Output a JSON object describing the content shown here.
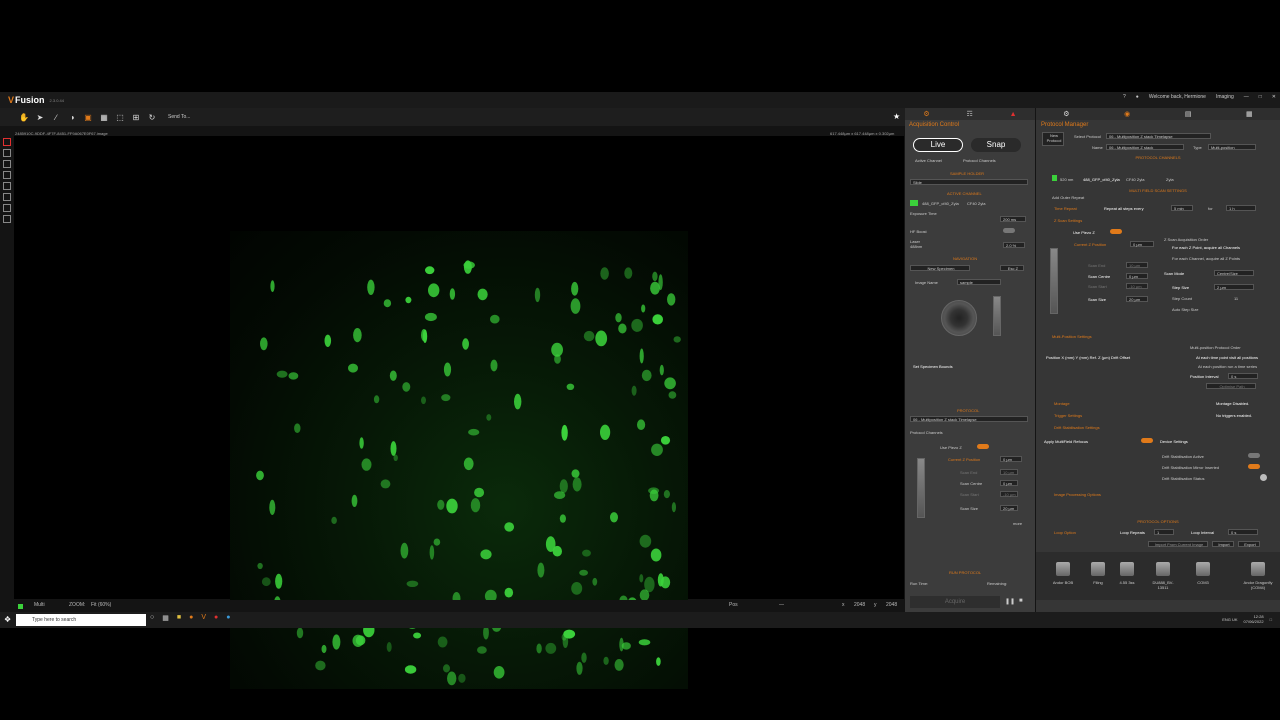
{
  "app": {
    "name": "Fusion",
    "version": "2.3.0.44",
    "welcome": "Welcome back, Hermione",
    "mode": "Imaging"
  },
  "toolbar": {
    "send_to": "Send To..."
  },
  "viewer": {
    "image_info": "2485910C-9DDF-4F7F-8451-FF9A067E0F67.image",
    "image_size": "617.448µm x 617.448µm x 0.302µm"
  },
  "statusbar": {
    "multi": "Multi",
    "zoom_label": "ZOOM:",
    "zoom_value": "Fit (60%)",
    "pos_label": "Pos",
    "pos_value": "—",
    "x_label": "x",
    "x_value": "2048",
    "y_label": "y",
    "y_value": "2048"
  },
  "acquisition": {
    "title": "Acquisition Control",
    "live": "Live",
    "snap": "Snap",
    "active_channel_radio": "Active Channel",
    "protocol_channels_radio": "Protocol Channels",
    "sample_holder": "SAMPLE HOLDER",
    "holder_value": "Slide",
    "active_channel": "ACTIVE CHANNEL",
    "channel_name": "488_GFP_cf40_Zyla",
    "channel_camera": "CF40 Zyla",
    "exposure_label": "Exposure Time",
    "exposure_value": "200 ms",
    "hf_boost": "HF Boost",
    "laser_label": "Laser",
    "laser_sub": "488nm",
    "laser_value": "2.0 %",
    "navigation": "NAVIGATION",
    "new_specimen": "New Specimen",
    "esc_z": "Esc Z",
    "image_name_label": "Image Name",
    "image_name_value": "sample",
    "set_specimen_bounds": "Set Specimen Bounds",
    "protocol": "PROTOCOL",
    "protocol_value": "06 - Multiposition Z stack Timelapse",
    "protocol_channels": "Protocol Channels",
    "use_piezo": "Use Piezo Z",
    "piezo_toggle": "ON",
    "current_z": "Current Z Position",
    "current_z_value": "0 µm",
    "scan_end": "Scan End",
    "scan_end_value": "10 µm",
    "scan_centre": "Scan Centre",
    "scan_centre_value": "0 µm",
    "scan_start": "Scan Start",
    "scan_start_value": "-10 µm",
    "scan_size": "Scan Size",
    "scan_size_value": "20 µm",
    "more": "more",
    "run_protocol": "RUN PROTOCOL",
    "run_time": "Run Time:",
    "remaining": "Remaining:",
    "acquire": "Acquire"
  },
  "protocol_manager": {
    "title": "Protocol Manager",
    "new_protocol": "New Protocol",
    "select_protocol_label": "Select Protocol",
    "select_protocol_value": "06 - Multiposition Z stack Timelapse",
    "name_label": "Name",
    "name_value": "06 - Multiposition Z stack",
    "type_label": "Type",
    "type_value": "Multi-position",
    "protocol_channels": "PROTOCOL CHANNELS",
    "channel_wavelength": "520 nm",
    "channel_name": "488_GFP_cf40_Zyla",
    "channel_cam": "CF40 Zyla",
    "channel_zyla": "Zyla",
    "multi_field_settings": "MULTI FIELD SCAN SETTINGS",
    "add_outer_repeat": "Add Outer Repeat",
    "time_repeat": "Time Repeat",
    "repeat_all": "Repeat all steps every",
    "repeat_every": "5 min",
    "for_label": "for",
    "for_value": "1 h",
    "z_scan_settings": "Z Scan Settings",
    "use_piezo": "Use Piezo Z",
    "current_z": "Current Z Position",
    "current_z_value": "0 µm",
    "scan_end": "Scan End",
    "scan_end_value": "10 µm",
    "scan_centre": "Scan Centre",
    "scan_centre_value": "0 µm",
    "scan_start": "Scan Start",
    "scan_start_value": "-10 µm",
    "scan_size": "Scan Size",
    "scan_size_value": "20 µm",
    "acq_order": "Z Scan Acquisition Order",
    "order_1": "For each Z Point, acquire all Channels",
    "order_2": "For each Channel, acquire all Z Points",
    "scan_mode": "Scan Mode",
    "scan_mode_value": "Centre/Size",
    "step_size": "Step Size",
    "step_size_value": "2 µm",
    "step_count": "Step Count",
    "step_count_value": "11",
    "auto_step": "Auto Step Size",
    "multi_position": "Multi-Position Settings",
    "position_cols": "Position  X (mm)  Y (mm)  Ref. Z (µm)  Drift Offset",
    "mp_order": "Multi-position Protocol Order",
    "mp_order_1": "At each time point visit all positions",
    "mp_order_2": "At each position run a time series",
    "position_interval": "Position Interval",
    "position_interval_value": "0 s",
    "optimise_path": "Optimise Path",
    "montage": "Montage",
    "montage_status": "Montage Disabled.",
    "trigger": "Trigger Settings",
    "trigger_status": "No triggers enabled.",
    "drift": "Drift Stabilisation Settings",
    "apply_refocus": "Apply MultiField Refocus",
    "device_settings": "Device Settings",
    "drift_active": "Drift Stabilisation Active",
    "drift_mirror": "Drift Stabilisation Mirror Inserted",
    "drift_status": "Drift Stabilisation Status",
    "image_processing": "Image Processing Options",
    "protocol_options": "PROTOCOL OPTIONS",
    "loop_option": "Loop Option",
    "loop_repeats": "Loop Repeats",
    "loop_repeats_value": "1",
    "loop_interval": "Loop Interval",
    "loop_interval_value": "0 s",
    "import_current": "Import From Current Image",
    "import": "Import",
    "export": "Export",
    "devices": [
      {
        "name": "Andor BOB"
      },
      {
        "name": "Filing"
      },
      {
        "name": "4.55 3ss"
      },
      {
        "name": "DU888_BV-13511"
      },
      {
        "name": "COM3"
      },
      {
        "name": "Andor Dragonfly (COM4)"
      }
    ]
  },
  "taskbar": {
    "search_placeholder": "Type here to search",
    "time": "12:28",
    "date": "07/06/2022",
    "lang": "ENG UK"
  },
  "colors": {
    "accent": "#e07a1a",
    "gfp": "#3bd13b",
    "panel": "#3c3c3c"
  }
}
